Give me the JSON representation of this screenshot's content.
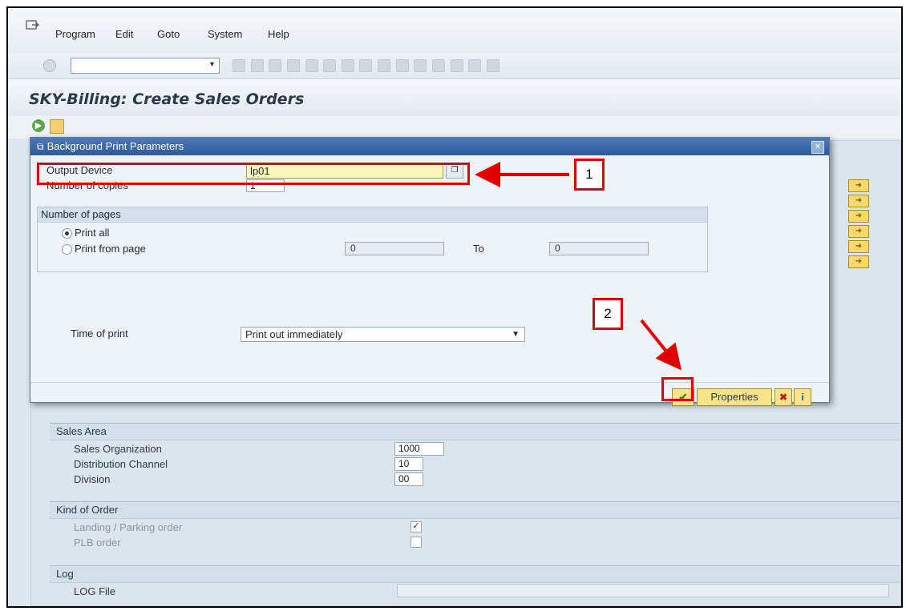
{
  "menu": {
    "items": [
      "Program",
      "Edit",
      "Goto",
      "System",
      "Help"
    ]
  },
  "title": "SKY-Billing: Create Sales Orders",
  "dialog": {
    "title": "Background Print Parameters",
    "output_device_label": "Output Device",
    "output_device_value": "lp01",
    "copies_label": "Number of copies",
    "copies_value": "1",
    "pages_group_title": "Number of pages",
    "print_all_label": "Print all",
    "print_from_label": "Print from page",
    "from_value": "0",
    "to_label": "To",
    "to_value": "0",
    "time_label": "Time of print",
    "time_value": "Print out immediately",
    "properties_label": "Properties"
  },
  "form": {
    "sales_area": {
      "title": "Sales Area",
      "rows": [
        {
          "label": "Sales Organization",
          "value": "1000"
        },
        {
          "label": "Distribution Channel",
          "value": "10"
        },
        {
          "label": "Division",
          "value": "00"
        }
      ]
    },
    "kind_of_order": {
      "title": "Kind of Order",
      "rows": [
        {
          "label": "Landing / Parking order",
          "checked": true
        },
        {
          "label": "PLB order",
          "checked": false
        }
      ]
    },
    "log": {
      "title": "Log",
      "row_label": "LOG File",
      "row_value": ""
    }
  },
  "annotations": {
    "callout_1": "1",
    "callout_2": "2",
    "color": "#e00000"
  },
  "colors": {
    "title_bar": "#2d5a9a",
    "button_yellow": "#fbe38a",
    "output_field": "#fff7c0"
  }
}
